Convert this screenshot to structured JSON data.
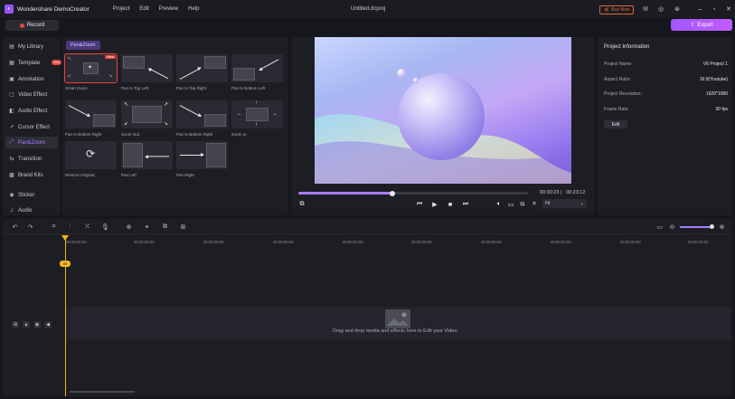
{
  "app": {
    "name": "Wondershare DemoCreator",
    "document_title": "Untitled.dcproj",
    "menu": [
      "Project",
      "Edit",
      "Preview",
      "Help"
    ],
    "buy_now": "Buy Now"
  },
  "record": {
    "label": "Record"
  },
  "export": {
    "label": "Export"
  },
  "sidebar": {
    "items": [
      {
        "label": "My Library",
        "icon": "library-icon"
      },
      {
        "label": "Template",
        "icon": "template-icon",
        "badge": "New"
      },
      {
        "label": "Annotation",
        "icon": "annotation-icon"
      },
      {
        "label": "Video Effect",
        "icon": "video-effect-icon"
      },
      {
        "label": "Audio Effect",
        "icon": "audio-effect-icon"
      },
      {
        "label": "Cursor Effect",
        "icon": "cursor-icon"
      },
      {
        "label": "Pan&Zoom",
        "icon": "pan-zoom-icon",
        "active": true
      },
      {
        "label": "Transition",
        "icon": "transition-icon"
      },
      {
        "label": "Brand Kits",
        "icon": "brand-kit-icon"
      },
      {
        "label": "Sticker",
        "icon": "sticker-icon"
      },
      {
        "label": "Audio",
        "icon": "audio-icon"
      }
    ]
  },
  "effects": {
    "tab": "Pan&Zoom",
    "items": [
      {
        "label": "Smart Zoom",
        "badge": "New",
        "selected": true
      },
      {
        "label": "Pan to Top Left"
      },
      {
        "label": "Pan to Top Right"
      },
      {
        "label": "Pan to Bottom Left"
      },
      {
        "label": "Pan to Bottom Right"
      },
      {
        "label": "Zoom Out"
      },
      {
        "label": "Pan to Bottom Right"
      },
      {
        "label": "Zoom In"
      },
      {
        "label": "Restore Original"
      },
      {
        "label": "Pan Left"
      },
      {
        "label": "Pan Right"
      }
    ]
  },
  "preview": {
    "current_time": "00:00:23",
    "total_time": "00:23:12",
    "progress": 0.41,
    "fit": "Fit"
  },
  "project_info": {
    "title": "Project Information",
    "rows": [
      {
        "label": "Project Name:",
        "value": "V6 Project 1"
      },
      {
        "label": "Aspect Ratio:",
        "value": "16:9(Youtube)"
      },
      {
        "label": "Project Resolution:",
        "value": "1920*1080"
      },
      {
        "label": "Frame Rate:",
        "value": "30 fps"
      }
    ],
    "edit": "Edit"
  },
  "timeline": {
    "ruler": [
      "00:00:00:00",
      "00:00:00:00",
      "00:00:00:00",
      "00:00:00:00",
      "00:00:00:00",
      "00:00:00:00",
      "00:00:00:00",
      "00:00:00:00",
      "00:00:00:00",
      "00:00:00:00"
    ],
    "drop_text": "Drag and drop media and effects here to Edit your Video.",
    "playhead_label": "00"
  }
}
